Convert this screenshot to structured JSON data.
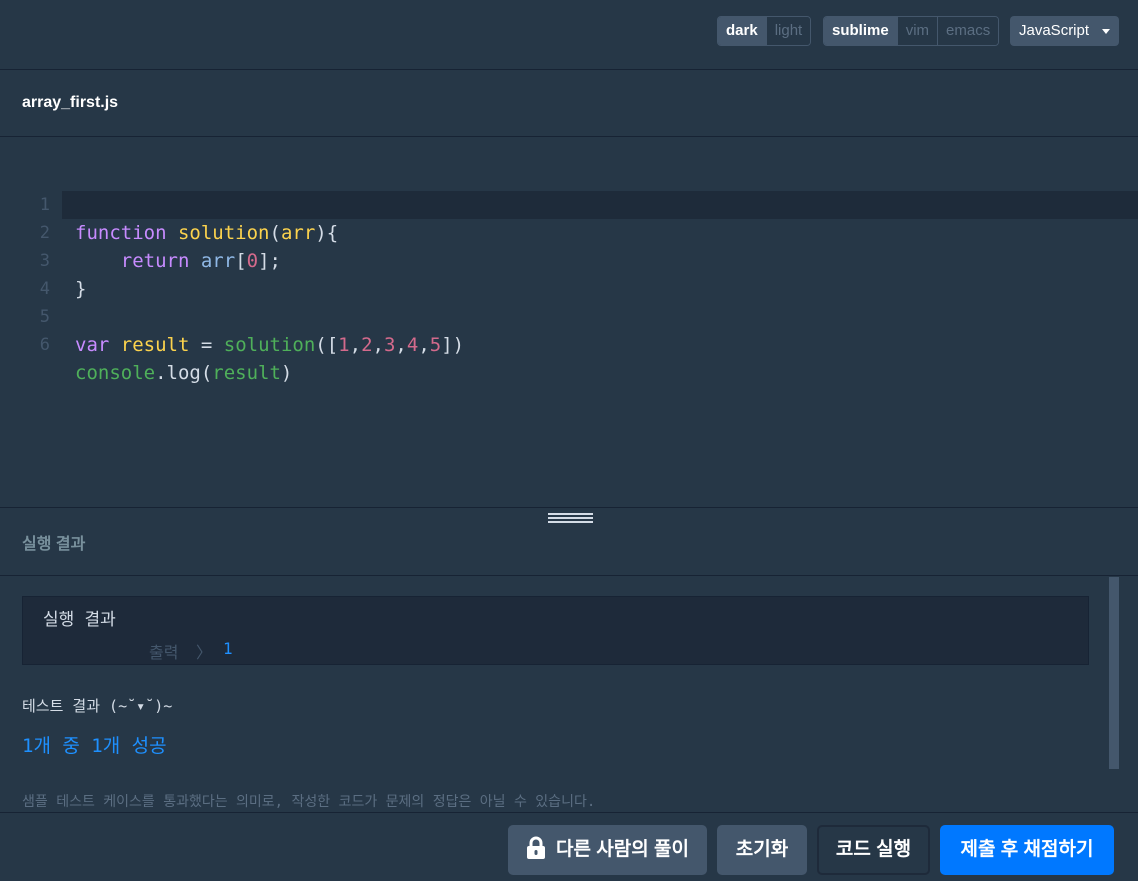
{
  "toolbar": {
    "themes": [
      "dark",
      "light"
    ],
    "theme_active": "dark",
    "keymaps": [
      "sublime",
      "vim",
      "emacs"
    ],
    "keymap_active": "sublime",
    "language": "JavaScript"
  },
  "file": {
    "name": "array_first.js"
  },
  "editor": {
    "line_numbers": [
      "1",
      "2",
      "3",
      "4",
      "5",
      "6"
    ],
    "active_line": 2
  },
  "result": {
    "title": "실행 결과",
    "output_title": "실행 결과",
    "output_label": "출력",
    "output_arrow": "〉",
    "output_value": "1",
    "test_title": "테스트 결과 (~˘▾˘)~",
    "test_summary": "1개 중 1개 성공",
    "test_note": "샘플 테스트 케이스를 통과했다는 의미로, 작성한 코드가 문제의 정답은 아닐 수 있습니다."
  },
  "buttons": {
    "other_solutions": "다른 사람의 풀이",
    "reset": "초기화",
    "run": "코드 실행",
    "submit": "제출 후 채점하기"
  },
  "colors": {
    "background": "#263747",
    "accent": "#0078ff",
    "button": "#44576c"
  }
}
